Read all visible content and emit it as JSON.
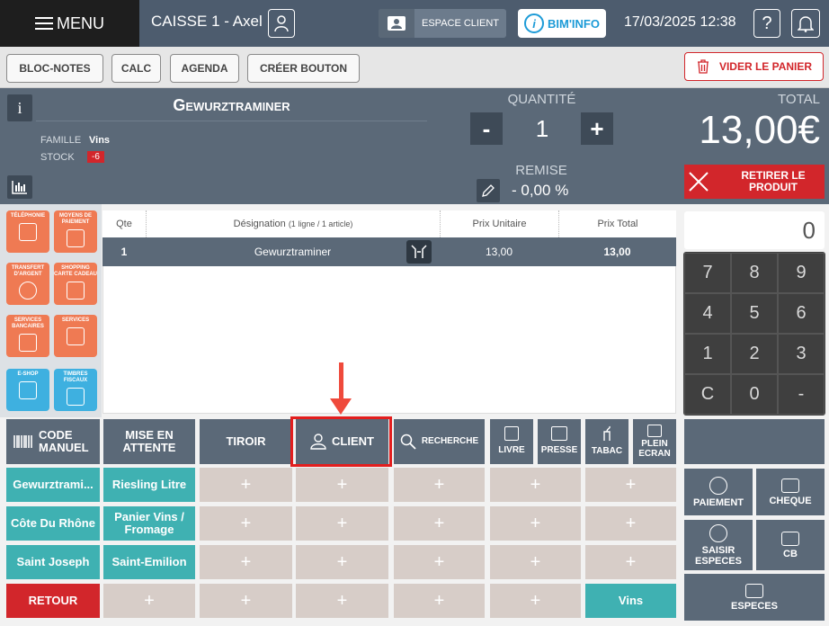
{
  "header": {
    "menu_label": "MENU",
    "register": "CAISSE 1 - Axel",
    "espace_client": "ESPACE CLIENT",
    "bim_info": "BIM'INFO",
    "datetime": "17/03/2025 12:38",
    "help_symbol": "?"
  },
  "toolbar": {
    "bloc_notes": "BLOC-NOTES",
    "calc": "CALC",
    "agenda": "AGENDA",
    "creer_bouton": "CRÉER BOUTON",
    "vider_panier": "VIDER LE PANIER"
  },
  "product": {
    "info_symbol": "i",
    "name": "Gewurztraminer",
    "famille_label": "FAMILLE",
    "famille_value": "Vins",
    "stock_label": "STOCK",
    "stock_value": "-6",
    "quantite_label": "QUANTITÉ",
    "quantite_value": "1",
    "minus": "-",
    "plus": "+",
    "remise_label": "REMISE",
    "remise_value": "- 0,00 %",
    "total_label": "TOTAL",
    "total_value": "13,00€",
    "retirer_label": "RETIRER LE PRODUIT"
  },
  "categories": [
    {
      "label": "TÉLÉPHONIE",
      "color": "orange"
    },
    {
      "label": "MOYENS DE PAIEMENT",
      "color": "orange"
    },
    {
      "label": "TRANSFERT D'ARGENT",
      "color": "orange"
    },
    {
      "label": "SHOPPING CARTE CADEAU",
      "color": "orange"
    },
    {
      "label": "SERVICES BANCAIRES",
      "color": "orange"
    },
    {
      "label": "SERVICES",
      "color": "orange"
    },
    {
      "label": "E-SHOP",
      "color": "blue"
    },
    {
      "label": "TIMBRES FISCAUX",
      "color": "blue"
    }
  ],
  "ticket": {
    "headers": {
      "qte": "Qte",
      "designation": "Désignation",
      "designation_note": "(1 ligne / 1 article)",
      "prix_unitaire": "Prix Unitaire",
      "prix_total": "Prix Total"
    },
    "rows": [
      {
        "qte": "1",
        "designation": "Gewurztraminer",
        "prix_unitaire": "13,00",
        "prix_total": "13,00"
      }
    ]
  },
  "keypad": {
    "display": "0",
    "keys": [
      "7",
      "8",
      "9",
      "4",
      "5",
      "6",
      "1",
      "2",
      "3",
      "C",
      "0",
      "-"
    ]
  },
  "functions": {
    "code_manuel": "CODE MANUEL",
    "mise_en_attente": "MISE EN ATTENTE",
    "tiroir": "TIROIR",
    "client": "CLIENT",
    "recherche": "RECHERCHE",
    "livre": "LIVRE",
    "presse": "PRESSE",
    "tabac": "TABAC",
    "plein_ecran": "PLEIN ECRAN"
  },
  "grid": {
    "row1": [
      "Gewurztrami...",
      "Riesling Litre"
    ],
    "row2": [
      "Côte Du Rhône",
      "Panier Vins / Fromage"
    ],
    "row3": [
      "Saint Joseph",
      "Saint-Emilion"
    ],
    "retour": "RETOUR",
    "vins": "Vins",
    "empty_symbol": "+"
  },
  "payment": {
    "paiement": "PAIEMENT",
    "cheque": "CHEQUE",
    "saisir_especes": "SAISIR ESPECES",
    "cb": "CB",
    "especes": "ESPECES"
  },
  "colors": {
    "accent_red": "#d2262b",
    "slate": "#5b6978",
    "teal": "#3fb1b2",
    "orange": "#ef7a53",
    "blue": "#3eb0e0",
    "highlight": "#e31e1e"
  }
}
